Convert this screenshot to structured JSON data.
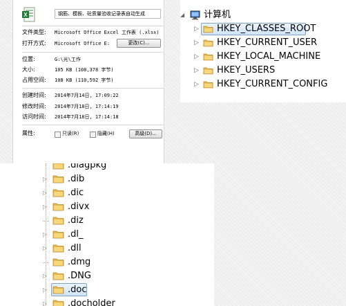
{
  "properties": {
    "file_name": "钢筋、模板、砼质量验收记录表自动生成",
    "type_label": "文件类型:",
    "type_value": "Microsoft Office Excel 工作表 (.xlsx)",
    "open_label": "打开方式:",
    "open_value": "Microsoft Office E:",
    "change_button": "更改(C)...",
    "location_label": "位置:",
    "location_value": "G:\\光\\工作",
    "size_label": "大小:",
    "size_value": "105 KB (108,378 字节)",
    "disk_label": "占用空间:",
    "disk_value": "108 KB (110,592 字节)",
    "created_label": "创建时间:",
    "created_value": "2014年7月14日, 17:09:22",
    "modified_label": "修改时间:",
    "modified_value": "2014年7月18日, 17:14:19",
    "accessed_label": "访问时间:",
    "accessed_value": "2014年7月18日, 17:14:18",
    "attr_label": "属性:",
    "readonly_label": "只读(R)",
    "hidden_label": "隐藏(H)",
    "advanced_button": "高级(D)..."
  },
  "registry": {
    "root_label": "计算机",
    "keys": [
      "HKEY_CLASSES_ROOT",
      "HKEY_CURRENT_USER",
      "HKEY_LOCAL_MACHINE",
      "HKEY_USERS",
      "HKEY_CURRENT_CONFIG"
    ],
    "selected_index": 0
  },
  "extensions": {
    "top_partial": ".diagpkg",
    "items": [
      {
        "label": ".dib",
        "expandable": true
      },
      {
        "label": ".dic",
        "expandable": true
      },
      {
        "label": ".divx",
        "expandable": true
      },
      {
        "label": ".diz",
        "expandable": false
      },
      {
        "label": ".dl_",
        "expandable": true
      },
      {
        "label": ".dll",
        "expandable": true
      },
      {
        "label": ".dmg",
        "expandable": false
      },
      {
        "label": ".DNG",
        "expandable": true
      },
      {
        "label": ".doc",
        "expandable": true
      }
    ],
    "bottom_partial": ".docholder",
    "selected_index": 8
  },
  "colors": {
    "folder": "#e8b94a",
    "selection": "#cfe4fa",
    "selection_border": "#7da2ce"
  }
}
